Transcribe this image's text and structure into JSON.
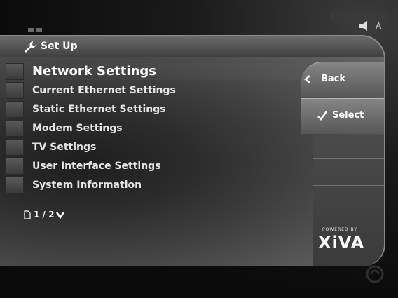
{
  "screen": {
    "output_label": "Output",
    "speaker_label": "A"
  },
  "header": {
    "title": "Set Up"
  },
  "menu": {
    "items": [
      {
        "label": "Network Settings",
        "selected": true
      },
      {
        "label": "Current Ethernet Settings",
        "selected": false
      },
      {
        "label": "Static Ethernet Settings",
        "selected": false
      },
      {
        "label": "Modem Settings",
        "selected": false
      },
      {
        "label": "TV Settings",
        "selected": false
      },
      {
        "label": "User Interface Settings",
        "selected": false
      },
      {
        "label": "System Information",
        "selected": false
      }
    ]
  },
  "actions": {
    "back_label": "Back",
    "select_label": "Select"
  },
  "pagination": {
    "text": "1 / 2"
  },
  "branding": {
    "powered_by": "POWERED BY",
    "logo": "XiVA"
  },
  "icons": {
    "setup": "wrench-icon",
    "back": "chevron-left-icon",
    "select": "checkmark-icon",
    "page": "page-icon",
    "next_page": "chevron-down-icon",
    "speaker": "speaker-icon"
  },
  "colors": {
    "background": "#0b0b0b",
    "panel": "#3e3e3e",
    "text": "#ffffff"
  }
}
